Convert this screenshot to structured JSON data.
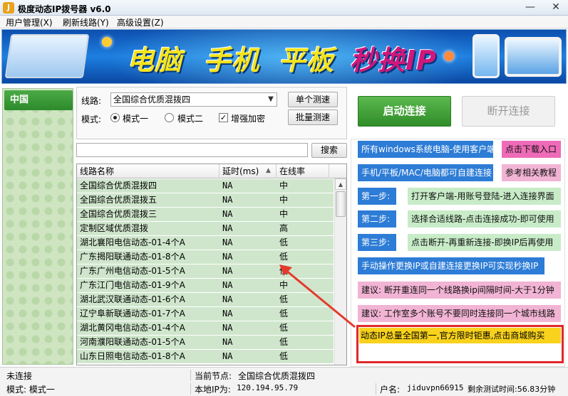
{
  "window": {
    "title": "极度动态IP拨号器 v6.0",
    "icon_text": "J",
    "min": "—",
    "max": "▭",
    "close": "✕"
  },
  "menu": [
    "用户管理(X)",
    "刷新线路(Y)",
    "高级设置(Z)"
  ],
  "banner": {
    "w1": "电脑",
    "w2": "手机",
    "w3": "平板",
    "w4": "秒换IP",
    "color_main": "#f5e41c",
    "color_accent": "#d1177b"
  },
  "left": {
    "country": "中国"
  },
  "options": {
    "route_label": "线路:",
    "route_value": "全国综合优质混拨四",
    "mode_label": "模式:",
    "mode1": "模式一",
    "mode2": "模式二",
    "encrypt": "增强加密",
    "btn_single": "单个测速",
    "btn_batch": "批量测速"
  },
  "connect": {
    "start": "启动连接",
    "stop": "断开连接"
  },
  "search": {
    "button": "搜索",
    "value": ""
  },
  "table": {
    "headers": [
      "线路名称",
      "延时(ms)",
      "在线率"
    ],
    "sort_icon": "▲",
    "rows": [
      [
        "全国综合优质混拨四",
        "NA",
        "中"
      ],
      [
        "全国综合优质混拨五",
        "NA",
        "中"
      ],
      [
        "全国综合优质混拨三",
        "NA",
        "中"
      ],
      [
        "定制区域优质混拨",
        "NA",
        "高"
      ],
      [
        "湖北襄阳电信动态-01-4个A",
        "NA",
        "低"
      ],
      [
        "广东揭阳联通动态-01-8个A",
        "NA",
        "低"
      ],
      [
        "广东广州电信动态-01-5个A",
        "NA",
        "低"
      ],
      [
        "广东江门电信动态-01-9个A",
        "NA",
        "中"
      ],
      [
        "湖北武汉联通动态-01-6个A",
        "NA",
        "低"
      ],
      [
        "辽宁阜新联通动态-01-7个A",
        "NA",
        "低"
      ],
      [
        "湖北黄冈电信动态-01-4个A",
        "NA",
        "低"
      ],
      [
        "河南濮阳联通动态-01-5个A",
        "NA",
        "低"
      ],
      [
        "山东日照电信动态-01-8个A",
        "NA",
        "低"
      ]
    ]
  },
  "info": {
    "r1a": "所有windows系统电脑-使用客户端",
    "r1b": "点击下载入口",
    "r2a": "手机/平板/MAC/电脑都可自建连接",
    "r2b": "参考相关教程",
    "s1": "第一步:",
    "s1t": "打开客户端-用账号登陆-进入连接界面",
    "s2": "第二步:",
    "s2t": "选择合适线路-点击连接成功-即可使用",
    "s3": "第三步:",
    "s3t": "点击断开-再重新连接-即换IP后再使用",
    "manual": "手动操作更换IP或自建连接更换IP可实现秒换IP",
    "tip1": "建议: 断开重连同一个线路换ip间隔时间-大于1分钟",
    "tip2": "建议: 工作室多个账号不要同时连接同一个城市线路",
    "promo": "动态IP总量全国第一,官方限时钜惠,点击商城购买"
  },
  "status": {
    "conn": "未连接",
    "node_label": "当前节点:",
    "node_value": "全国综合优质混拨四",
    "mode": "模式: 模式一",
    "ip_label": "本地IP为:",
    "ip_value": "120.194.95.79",
    "user_label": "户名:",
    "user_value": "jiduvpn66915",
    "trial": "剩余测试时间:56.83分钟"
  }
}
